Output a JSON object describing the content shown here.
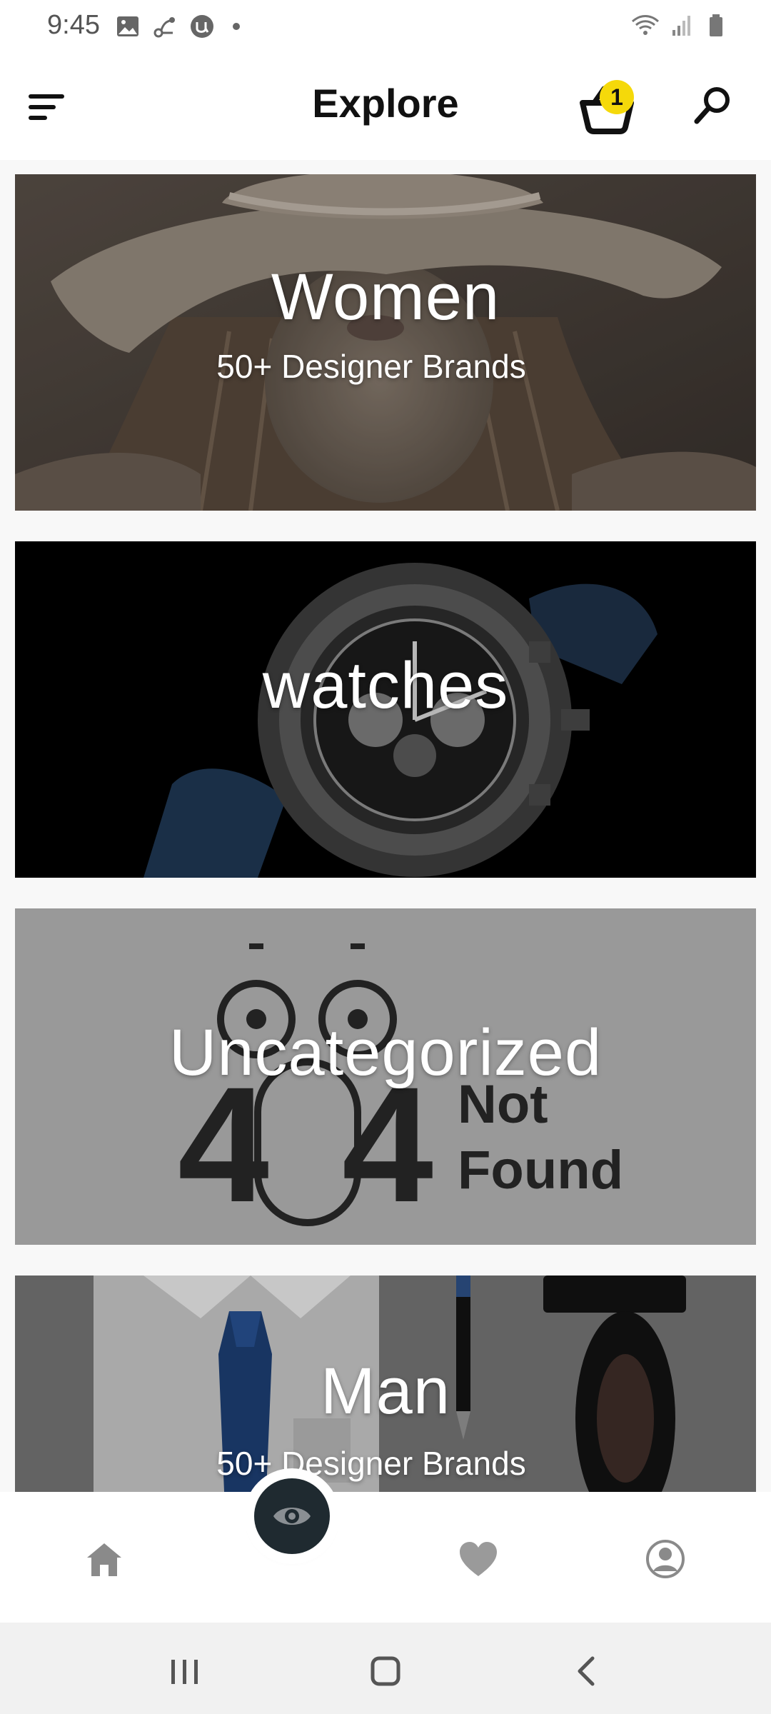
{
  "status_bar": {
    "time": "9:45",
    "left_icons": [
      "gallery-icon",
      "share-icon",
      "app-u-icon",
      "notification-dot-icon"
    ],
    "right_icons": [
      "wifi-icon",
      "signal-icon",
      "battery-icon"
    ]
  },
  "app_bar": {
    "title": "Explore",
    "menu_icon": "menu-icon",
    "cart_icon": "basket-icon",
    "cart_count": "1",
    "search_icon": "search-icon",
    "badge_color": "#f5d90a"
  },
  "categories": [
    {
      "title": "Women",
      "subtitle": "50+ Designer Brands",
      "image": "woman-in-hat-photo"
    },
    {
      "title": "watches",
      "subtitle": "",
      "image": "wristwatch-photo"
    },
    {
      "title": "Uncategorized",
      "subtitle": "",
      "image": "404-not-found-illustration",
      "image_text": [
        "404",
        "Not",
        "Found"
      ]
    },
    {
      "title": "Man",
      "subtitle": "50+ Designer Brands",
      "image": "shirt-tie-shoes-photo"
    }
  ],
  "bottom_nav": {
    "items": [
      "home-icon",
      "eye-icon",
      "heart-icon",
      "profile-icon"
    ],
    "fab_color": "#1f2a30"
  },
  "system_nav": {
    "items": [
      "recent-apps-icon",
      "home-button-icon",
      "back-icon"
    ]
  }
}
